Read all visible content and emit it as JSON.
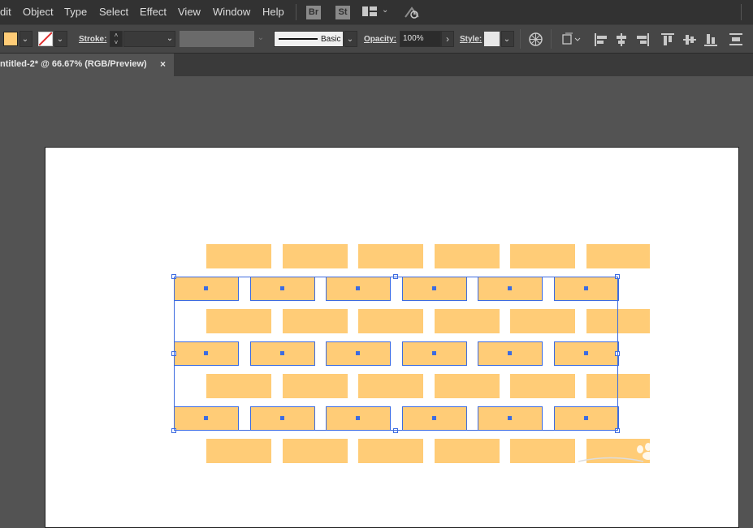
{
  "menubar": {
    "items": [
      "dit",
      "Object",
      "Type",
      "Select",
      "Effect",
      "View",
      "Window",
      "Help"
    ],
    "apps": [
      "Br",
      "St"
    ]
  },
  "controlbar": {
    "fill_color": "#ffcc77",
    "stroke_label": "Stroke:",
    "brush_label": "Basic",
    "opacity_label": "Opacity:",
    "opacity_value": "100%",
    "style_label": "Style:"
  },
  "document": {
    "tab_title": "ntitled-2* @ 66.67% (RGB/Preview)",
    "close_glyph": "×"
  },
  "artwork": {
    "brick_color": "#ffcc77",
    "selection_color": "#3d6be0",
    "rows": 7,
    "bricks_per_row": 6,
    "selected_rows": [
      2,
      4,
      6
    ]
  }
}
